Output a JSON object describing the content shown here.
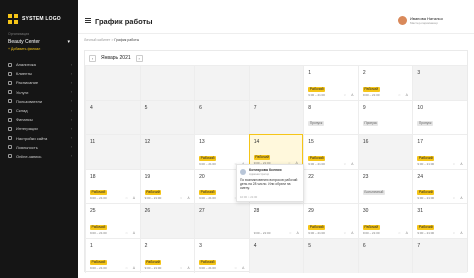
{
  "sidebar": {
    "logo": "SYSTEM LOGO",
    "org_caption": "Организация",
    "org": "Beauty Center",
    "add": "+ Добавить филиал",
    "items": [
      {
        "label": "Аналитика",
        "icon": "chart-icon"
      },
      {
        "label": "Клиенты",
        "icon": "users-icon"
      },
      {
        "label": "Расписание",
        "icon": "calendar-icon"
      },
      {
        "label": "Услуги",
        "icon": "service-icon"
      },
      {
        "label": "Пользователи",
        "icon": "user-icon"
      },
      {
        "label": "Склад",
        "icon": "box-icon"
      },
      {
        "label": "Финансы",
        "icon": "wallet-icon"
      },
      {
        "label": "Интеграции",
        "icon": "plug-icon"
      },
      {
        "label": "Настройки сайта",
        "icon": "gear-icon"
      },
      {
        "label": "Лояльность",
        "icon": "heart-icon"
      },
      {
        "label": "Online-запись",
        "icon": "globe-icon"
      }
    ]
  },
  "header": {
    "title": "График работы",
    "user_name": "Иванова Наталья",
    "user_role": "Мастер-парикмахер"
  },
  "breadcrumb": {
    "parent": "Личный кабинет",
    "sep": ">",
    "current": "График работы"
  },
  "calendar": {
    "month": "Январь 2021",
    "prev": "‹",
    "next": "›",
    "cells": [
      {
        "d": "",
        "t": "grey"
      },
      {
        "d": "",
        "t": "grey"
      },
      {
        "d": "",
        "t": "grey"
      },
      {
        "d": "",
        "t": "grey"
      },
      {
        "d": "1",
        "b": "Рабочий",
        "time": "9:00 – 21:00",
        "ic": true
      },
      {
        "d": "2",
        "b": "Рабочий",
        "time": "9:00 – 21:00",
        "ic": true
      },
      {
        "d": "3",
        "t": "grey"
      },
      {
        "d": "4",
        "t": "grey"
      },
      {
        "d": "5",
        "t": "grey"
      },
      {
        "d": "6",
        "t": "grey"
      },
      {
        "d": "7",
        "t": "grey"
      },
      {
        "d": "8",
        "tag": "Пропуск"
      },
      {
        "d": "9",
        "tag": "Пропуск"
      },
      {
        "d": "10",
        "tag": "Пропуск"
      },
      {
        "d": "11",
        "t": "grey"
      },
      {
        "d": "12",
        "t": "grey"
      },
      {
        "d": "13",
        "b": "Рабочий",
        "time": "9:00 – 21:00",
        "ic": true
      },
      {
        "d": "14",
        "t": "today",
        "b": "Рабочий",
        "time": "9:00 – 21:00",
        "ic": true
      },
      {
        "d": "15",
        "b": "Рабочий",
        "time": "9:00 – 21:00",
        "ic": true
      },
      {
        "d": "16",
        "t": "grey"
      },
      {
        "d": "17",
        "b": "Рабочий",
        "time": "9:00 – 21:00",
        "ic": true
      },
      {
        "d": "18",
        "b": "Рабочий",
        "time": "9:00 – 21:00",
        "ic": true
      },
      {
        "d": "19",
        "b": "Рабочий",
        "time": "9:00 – 21:00",
        "ic": true
      },
      {
        "d": "20",
        "b": "Рабочий",
        "time": "9:00 – 21:00",
        "ic": true
      },
      {
        "d": "21",
        "b": "Рабочий",
        "time": "9:00 – 21:00",
        "ic": true
      },
      {
        "d": "22"
      },
      {
        "d": "23",
        "tag": "Больничный"
      },
      {
        "d": "24",
        "b": "Рабочий",
        "time": "9:00 – 21:00",
        "ic": true
      },
      {
        "d": "25",
        "b": "Рабочий",
        "time": "9:00 – 21:00",
        "ic": true
      },
      {
        "d": "26",
        "t": "grey"
      },
      {
        "d": "27",
        "t": "grey"
      },
      {
        "d": "28",
        "time": "9:00 – 21:00",
        "ic": true
      },
      {
        "d": "29",
        "b": "Рабочий",
        "time": "9:00 – 21:00",
        "ic": true
      },
      {
        "d": "30",
        "b": "Рабочий",
        "time": "9:00 – 21:00",
        "ic": true
      },
      {
        "d": "31",
        "b": "Рабочий",
        "time": "9:00 – 21:00",
        "ic": true
      },
      {
        "d": "1",
        "b": "Рабочий",
        "time": "9:00 – 21:00",
        "ic": true
      },
      {
        "d": "2",
        "b": "Рабочий",
        "time": "9:00 – 21:00",
        "ic": true
      },
      {
        "d": "3",
        "b": "Рабочий",
        "time": "9:00 – 21:00",
        "ic": true
      },
      {
        "d": "4",
        "t": "grey"
      },
      {
        "d": "5",
        "t": "grey"
      },
      {
        "d": "6",
        "t": "grey"
      },
      {
        "d": "7",
        "t": "grey"
      }
    ]
  },
  "popup": {
    "name": "Котлярова Ксения",
    "role": "Администратор",
    "text": "По возникновению вопросов рабочий день на 28 число. Или обрати на смену.",
    "time": "10:00 ○ 21:00"
  },
  "colors": {
    "accent": "#f5c518",
    "sidebar_bg": "#151515"
  }
}
